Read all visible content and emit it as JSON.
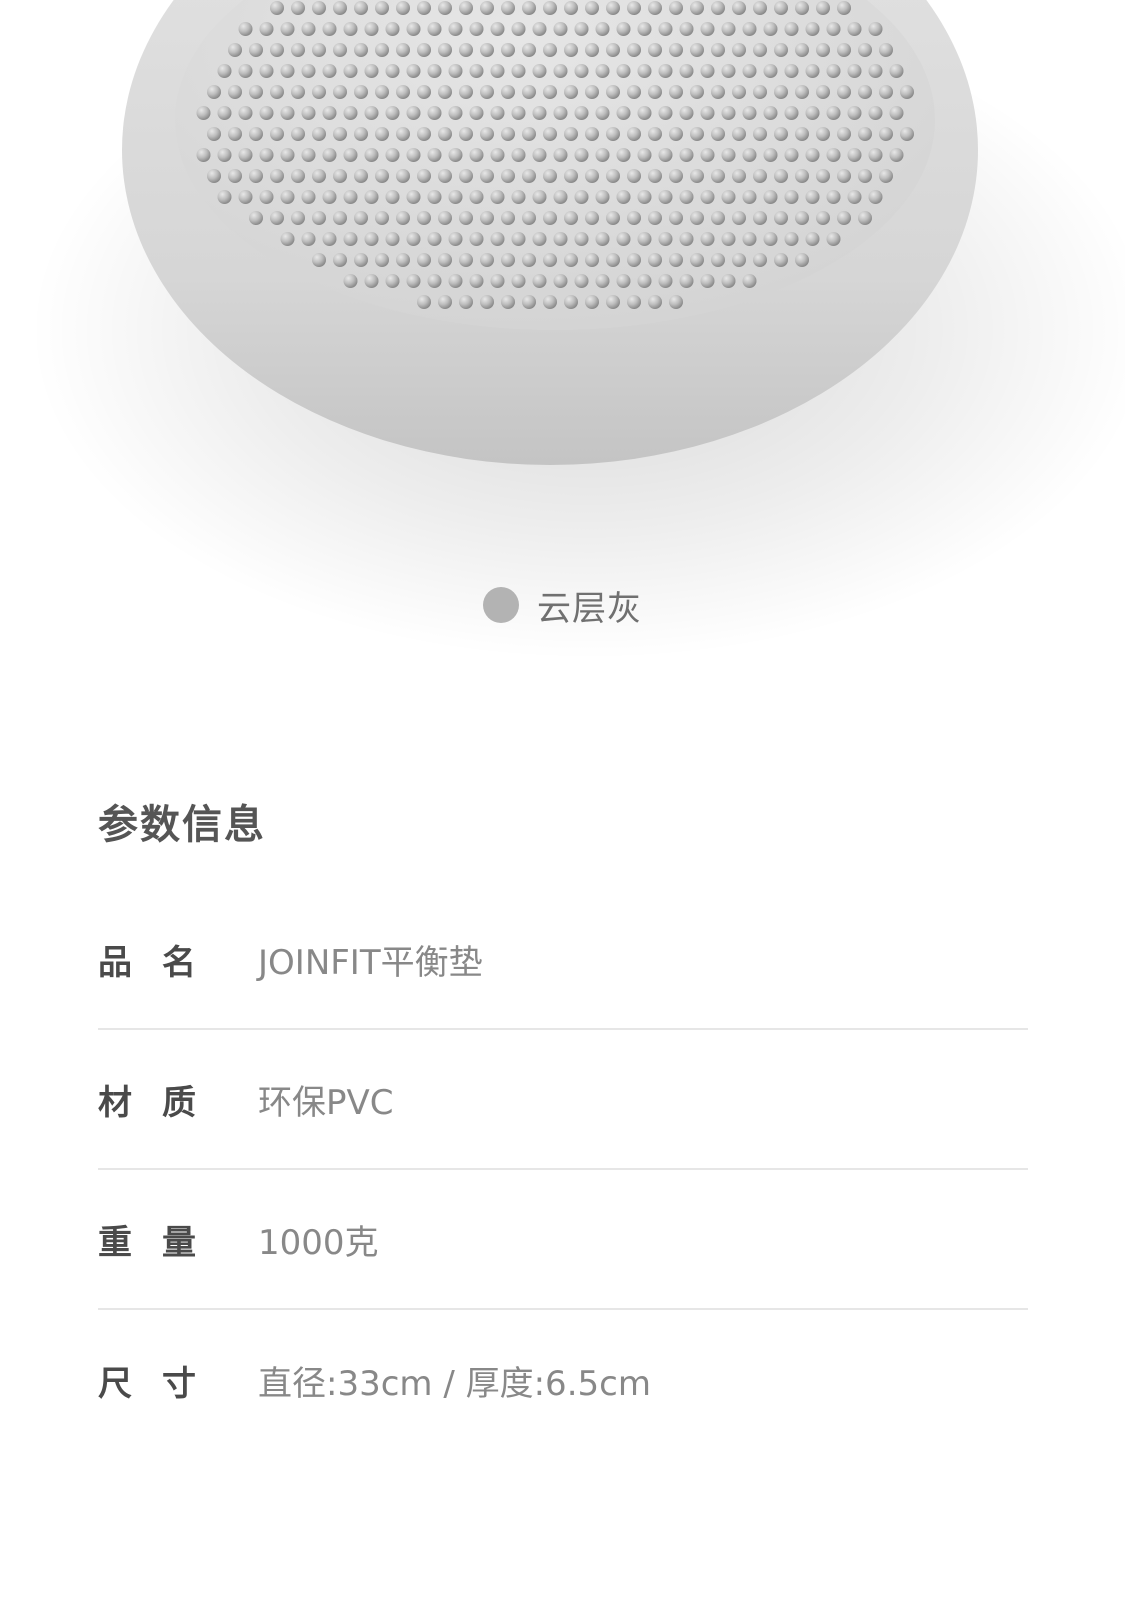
{
  "product": {
    "image_name": "balance-cushion-image",
    "color_option": {
      "label": "云层灰",
      "swatch_color": "#b3b3b3"
    }
  },
  "specs": {
    "title": "参数信息",
    "rows": [
      {
        "label": "品名",
        "value": "JOINFIT平衡垫"
      },
      {
        "label": "材质",
        "value": "环保PVC"
      },
      {
        "label": "重量",
        "value": "1000克"
      },
      {
        "label": "尺寸",
        "value": "直径:33cm / 厚度:6.5cm"
      }
    ]
  },
  "colors": {
    "cushion_surface": "#d9d9d9",
    "cushion_bump": "#c2c2c2",
    "title_text": "#555555",
    "label_text": "#4a4a4a",
    "value_text": "#888888",
    "divider": "#e6e6e6"
  }
}
